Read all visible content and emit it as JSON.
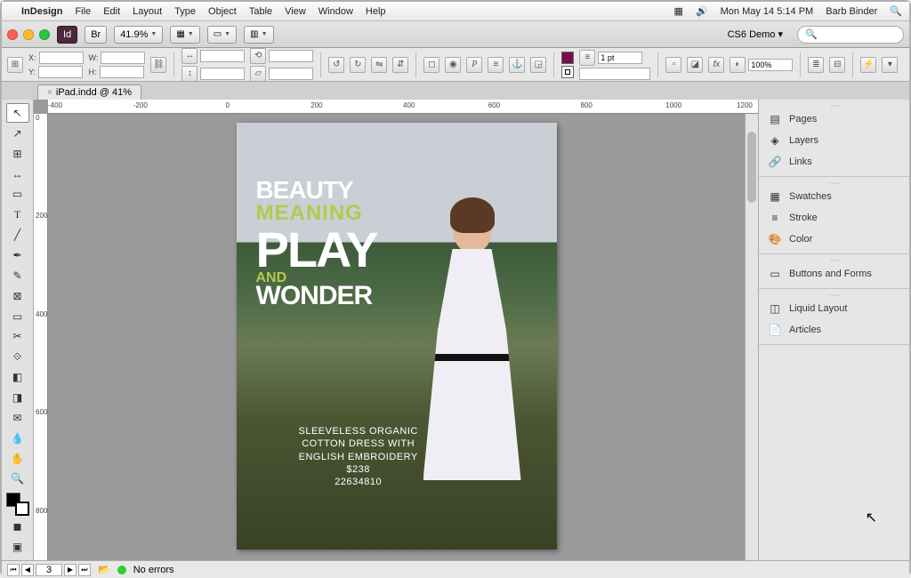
{
  "menubar": {
    "app": "InDesign",
    "items": [
      "File",
      "Edit",
      "Layout",
      "Type",
      "Object",
      "Table",
      "View",
      "Window",
      "Help"
    ],
    "clock": "Mon May 14  5:14 PM",
    "user": "Barb Binder"
  },
  "toolbar1": {
    "id_label": "Id",
    "br_label": "Br",
    "zoom": "41.9%",
    "doc_label": "CS6 Demo"
  },
  "controlbar": {
    "x_label": "X:",
    "y_label": "Y:",
    "w_label": "W:",
    "h_label": "H:",
    "stroke_weight": "1 pt",
    "opacity": "100%"
  },
  "tab": {
    "title": "iPad.indd @ 41%"
  },
  "hruler_ticks": [
    "-400",
    "-200",
    "0",
    "200",
    "400",
    "600",
    "800",
    "1000",
    "1200"
  ],
  "vruler_ticks": [
    "0",
    "200",
    "400",
    "600",
    "800"
  ],
  "page": {
    "headline": {
      "l1": "BEAUTY",
      "l2": "MEANING",
      "l3": "PLAY",
      "l4": "AND",
      "l5": "WONDER"
    },
    "caption": {
      "l1": "SLEEVELESS ORGANIC",
      "l2": "COTTON DRESS WITH",
      "l3": "ENGLISH EMBROIDERY",
      "l4": "$238",
      "l5": "22634810"
    }
  },
  "panels": {
    "g1": [
      "Pages",
      "Layers",
      "Links"
    ],
    "g2": [
      "Swatches",
      "Stroke",
      "Color"
    ],
    "g3": [
      "Buttons and Forms"
    ],
    "g4": [
      "Liquid Layout",
      "Articles"
    ]
  },
  "statusbar": {
    "page": "3",
    "errors": "No errors"
  }
}
